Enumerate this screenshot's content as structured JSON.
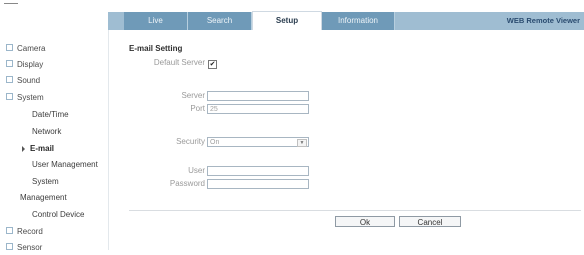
{
  "header": {
    "tabs": [
      {
        "label": "Live"
      },
      {
        "label": "Search"
      },
      {
        "label": "Setup",
        "active": true
      },
      {
        "label": "Information"
      }
    ],
    "brand": "WEB Remote Viewer"
  },
  "sidebar": {
    "items": [
      {
        "label": "Camera"
      },
      {
        "label": "Display"
      },
      {
        "label": "Sound"
      },
      {
        "label": "System"
      },
      {
        "label": "Date/Time"
      },
      {
        "label": "Network"
      },
      {
        "label": "E-mail"
      },
      {
        "label": "User Management"
      },
      {
        "label": "System"
      },
      {
        "label": "Management"
      },
      {
        "label": "Control Device"
      },
      {
        "label": "Record"
      },
      {
        "label": "Sensor"
      }
    ]
  },
  "main": {
    "title": "E-mail Setting",
    "default_server_label": "Default Server",
    "default_server_checked": "✔",
    "server_label": "Server",
    "server_value": "",
    "port_label": "Port",
    "port_value": "25",
    "security_label": "Security",
    "security_value": "On",
    "user_label": "User",
    "user_value": "",
    "password_label": "Password",
    "password_value": "",
    "ok_label": "Ok",
    "cancel_label": "Cancel"
  }
}
